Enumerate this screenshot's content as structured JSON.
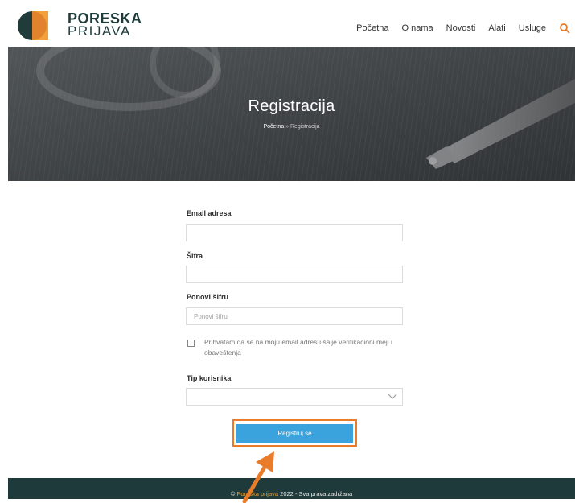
{
  "header": {
    "logo": {
      "line1": "PORESKA",
      "line2": "PRIJAVA"
    },
    "nav": [
      "Početna",
      "O nama",
      "Novosti",
      "Alati",
      "Usluge"
    ],
    "search_icon": "search-icon"
  },
  "hero": {
    "title": "Registracija",
    "breadcrumb": {
      "home": "Početna",
      "separator": "»",
      "current": "Registracija"
    }
  },
  "form": {
    "email": {
      "label": "Email adresa",
      "value": "",
      "placeholder": ""
    },
    "password": {
      "label": "Šifra",
      "value": "",
      "placeholder": ""
    },
    "repeat_password": {
      "label": "Ponovi šifru",
      "placeholder": "Ponovi šifru"
    },
    "consent": {
      "checked": false,
      "text": "Prihvatam da se na moju email adresu šalje verifikacioni mejl i obaveštenja"
    },
    "user_type": {
      "label": "Tip korisnika",
      "selected": ""
    },
    "submit_label": "Registruj se"
  },
  "footer": {
    "copyright": "©",
    "brand": "Poreska prijava",
    "rest": "2022 - Sva prava zadržana"
  },
  "colors": {
    "brand_dark": "#1f3c3b",
    "accent_orange": "#e87c2b",
    "button_blue": "#3aa3de",
    "footer_bg": "#1f3a3a"
  }
}
